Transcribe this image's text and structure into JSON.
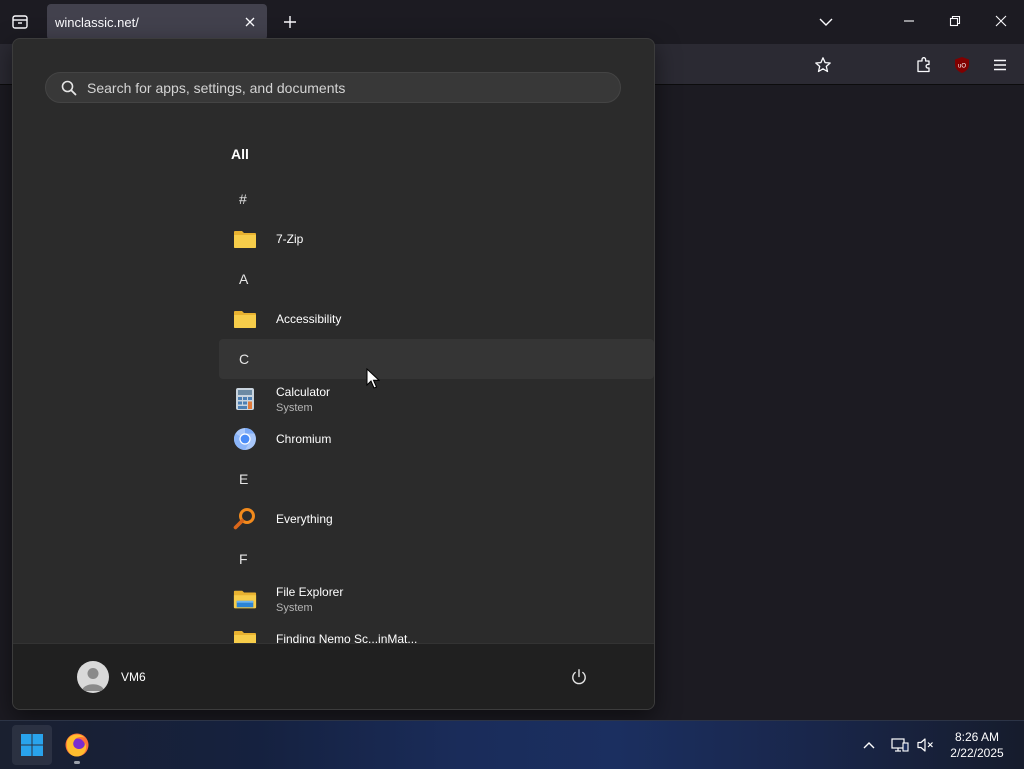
{
  "browser": {
    "tab_title": "winclassic.net/"
  },
  "start_menu": {
    "search_placeholder": "Search for apps, settings, and documents",
    "all_label": "All",
    "items": [
      {
        "kind": "letter",
        "label": "#"
      },
      {
        "kind": "app",
        "name": "7-Zip",
        "icon": "folder-icon"
      },
      {
        "kind": "letter",
        "label": "A"
      },
      {
        "kind": "app",
        "name": "Accessibility",
        "icon": "folder-icon"
      },
      {
        "kind": "letter",
        "label": "C"
      },
      {
        "kind": "app",
        "name": "Calculator",
        "sub": "System",
        "icon": "calculator-icon"
      },
      {
        "kind": "app",
        "name": "Chromium",
        "icon": "chromium-icon"
      },
      {
        "kind": "letter",
        "label": "E"
      },
      {
        "kind": "app",
        "name": "Everything",
        "icon": "magnifier-icon"
      },
      {
        "kind": "letter",
        "label": "F"
      },
      {
        "kind": "app",
        "name": "File Explorer",
        "sub": "System",
        "icon": "file-explorer-icon"
      },
      {
        "kind": "app",
        "name": "Finding Nemo Sc...inMat...",
        "icon": "folder-icon"
      }
    ],
    "user_name": "VM6"
  },
  "taskbar": {
    "time": "8:26 AM",
    "date": "2/22/2025"
  },
  "colors": {
    "folder_yellow": "#f5c542",
    "chromium_blue": "#4b8df8",
    "ublock_red": "#800000",
    "windows_blue": "#29a3ec"
  }
}
